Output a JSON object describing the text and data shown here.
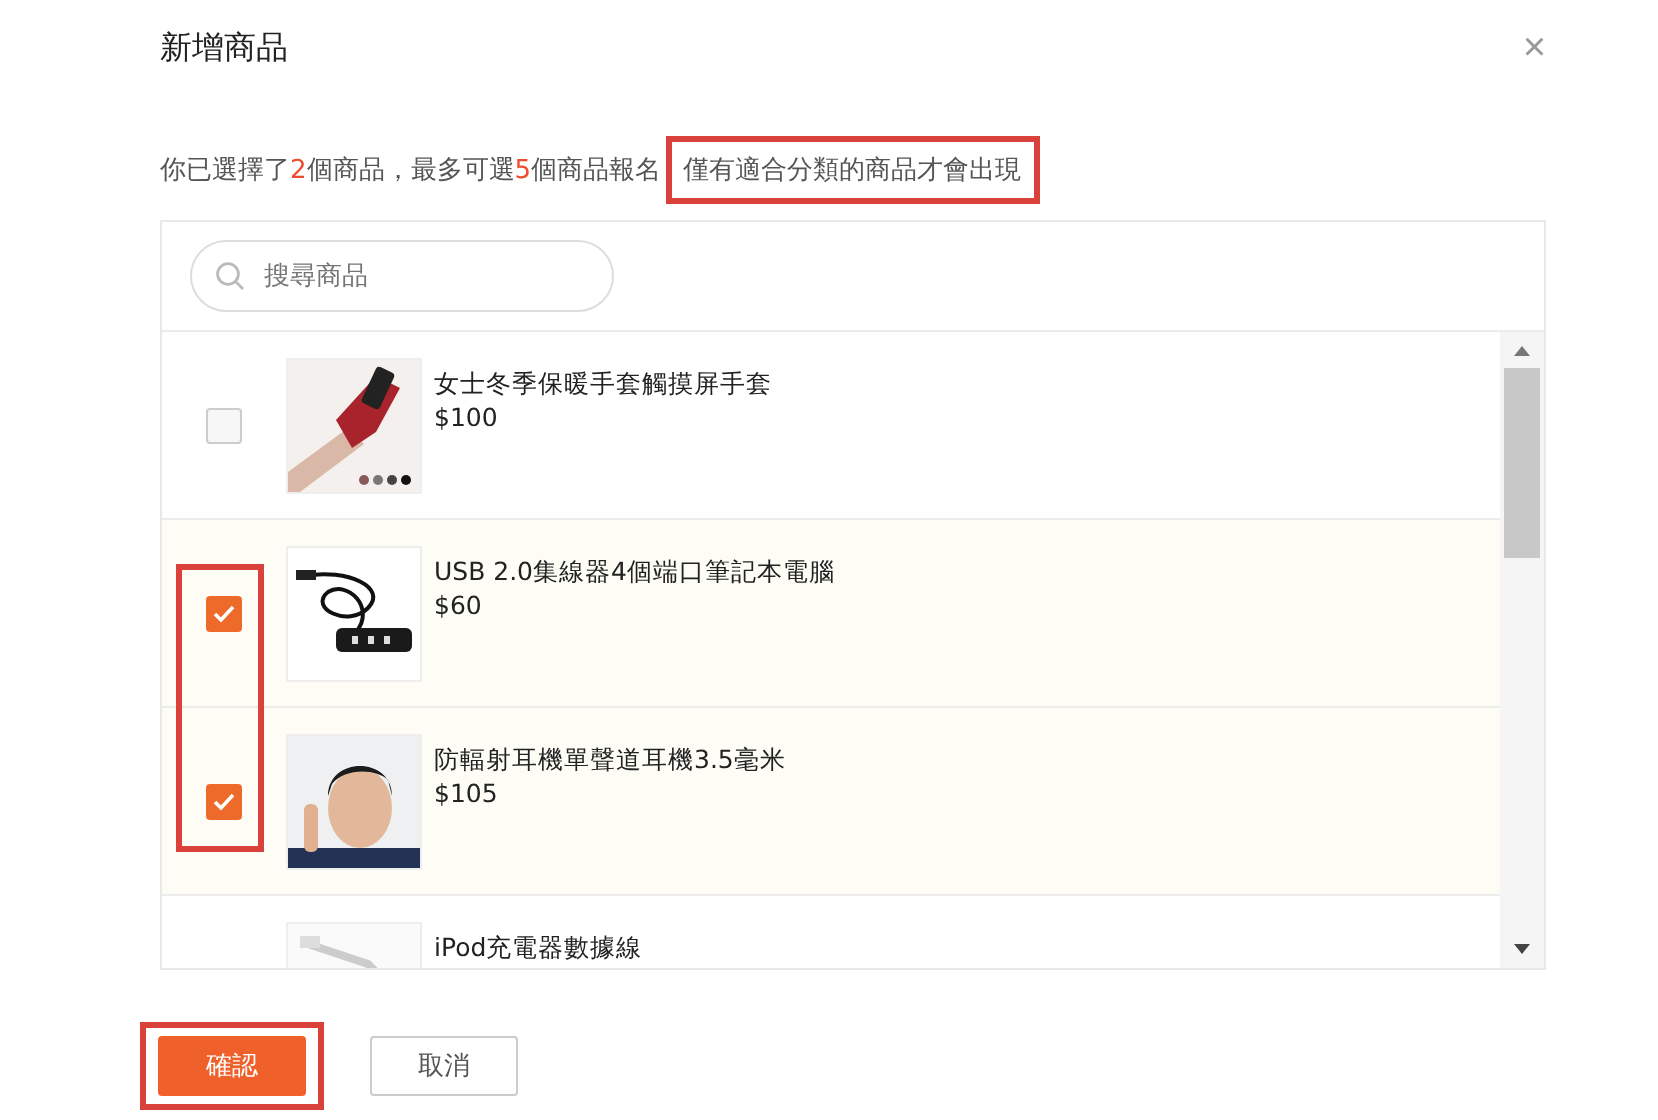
{
  "dialog": {
    "title": "新增商品",
    "close": "×"
  },
  "notice": {
    "parts": [
      {
        "text": "你已選擇了",
        "kind": "plain"
      },
      {
        "text": "2",
        "kind": "count"
      },
      {
        "text": "個商品，最多可選",
        "kind": "plain"
      },
      {
        "text": "5",
        "kind": "count"
      },
      {
        "text": "個商品報名",
        "kind": "plain"
      }
    ],
    "hint": {
      "text": "僅有適合分類的商品才會出現",
      "highlighted": true
    }
  },
  "search": {
    "placeholder": "搜尋商品"
  },
  "products": {
    "checkbox_column_highlighted": true,
    "rows": [
      {
        "name": "女士冬季保暖手套觸摸屏手套",
        "price": "$100",
        "checked": false
      },
      {
        "name": "USB 2.0集線器4個端口筆記本電腦",
        "price": "$60",
        "checked": true
      },
      {
        "name": "防輻射耳機單聲道耳機3.5毫米",
        "price": "$105",
        "checked": true
      },
      {
        "name": "iPod充電器數據線"
      }
    ]
  },
  "buttons": [
    {
      "label": "確認",
      "kind": "primary",
      "highlighted": true
    },
    {
      "label": "取消",
      "kind": "secondary",
      "highlighted": false
    }
  ]
}
